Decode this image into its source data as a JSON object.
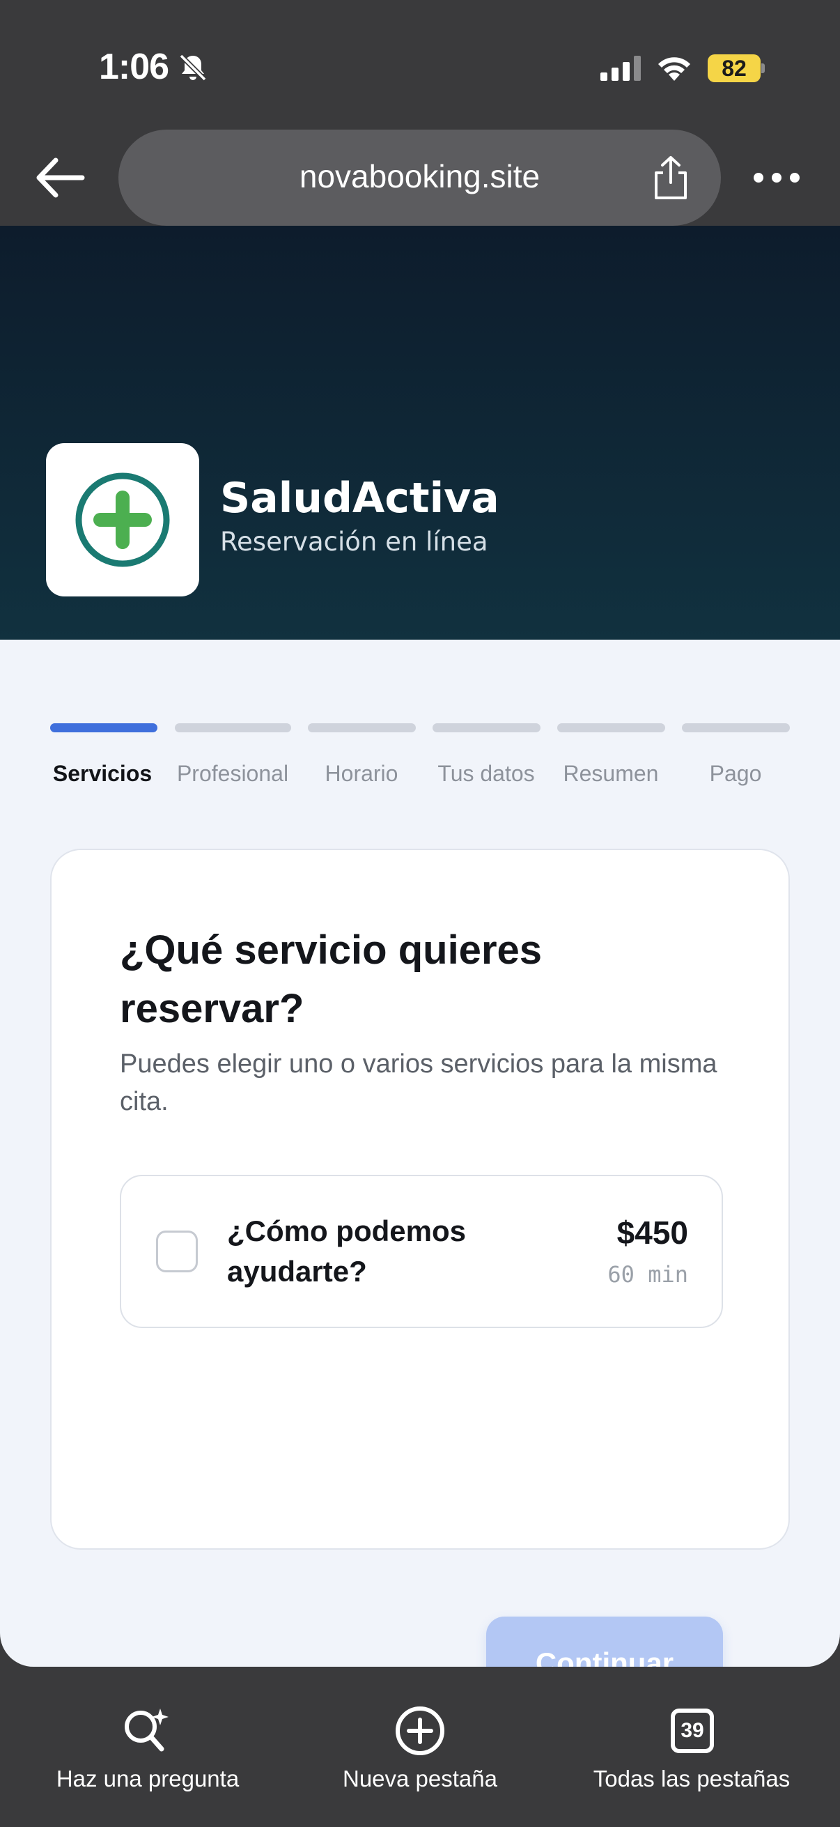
{
  "status_bar": {
    "time": "1:06",
    "battery": "82"
  },
  "browser": {
    "url": "novabooking.site"
  },
  "hero": {
    "brand_name": "SaludActiva",
    "brand_subtitle": "Reservación en línea",
    "logo_color": "#1a7a72",
    "logo_cross_color": "#4caf50"
  },
  "steps": [
    {
      "label": "Servicios",
      "active": true
    },
    {
      "label": "Profesional",
      "active": false
    },
    {
      "label": "Horario",
      "active": false
    },
    {
      "label": "Tus datos",
      "active": false
    },
    {
      "label": "Resumen",
      "active": false
    },
    {
      "label": "Pago",
      "active": false
    }
  ],
  "card": {
    "title": "¿Qué servicio quieres reservar?",
    "description": "Puedes elegir uno o varios servicios para la misma cita.",
    "service": {
      "name": "¿Cómo podemos ayudarte?",
      "price": "$450",
      "duration": "60 min",
      "checked": false
    },
    "continue_label": "Continuar",
    "continue_enabled": false
  },
  "toolbar": {
    "ask": "Haz una pregunta",
    "new_tab": "Nueva pestaña",
    "all_tabs": "Todas las pestañas",
    "tab_count": "39"
  },
  "colors": {
    "accent": "#3f6fdc",
    "accent_disabled": "#b3c7f4",
    "page_bg": "#f1f4fa"
  }
}
